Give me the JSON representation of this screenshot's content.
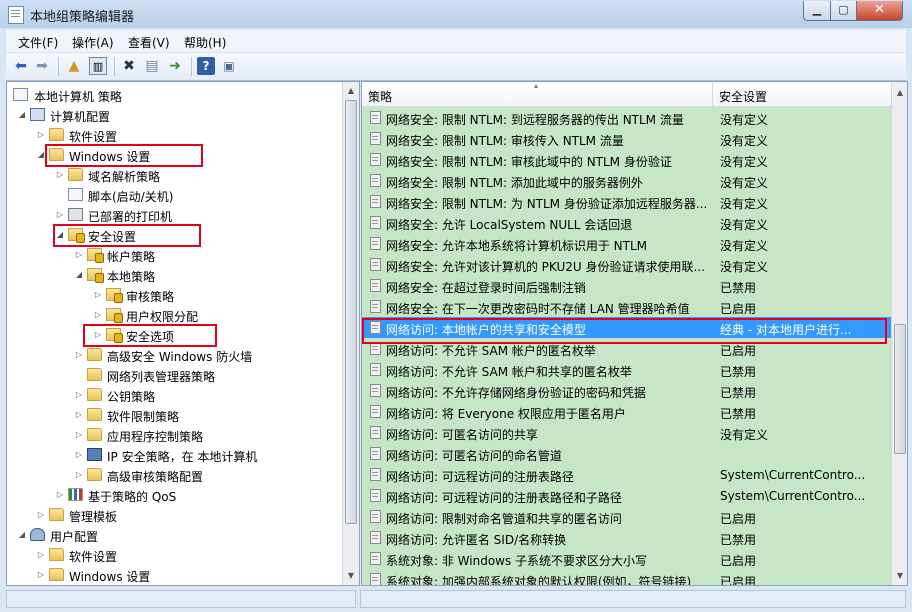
{
  "window": {
    "title": "本地组策略编辑器"
  },
  "menu": [
    "文件(F)",
    "操作(A)",
    "查看(V)",
    "帮助(H)"
  ],
  "tree": [
    {
      "label": "本地计算机 策略",
      "icon": "computer-policy-icon",
      "level": 0,
      "toggle": ""
    },
    {
      "label": "计算机配置",
      "icon": "computer-icon",
      "level": 1,
      "toggle": "expanded"
    },
    {
      "label": "软件设置",
      "icon": "folder-icon",
      "level": 2,
      "toggle": "collapsed"
    },
    {
      "label": "Windows 设置",
      "icon": "folder-icon",
      "level": 2,
      "toggle": "expanded"
    },
    {
      "label": "域名解析策略",
      "icon": "folder-icon",
      "level": 3,
      "toggle": "collapsed"
    },
    {
      "label": "脚本(启动/关机)",
      "icon": "script-icon",
      "level": 3,
      "toggle": ""
    },
    {
      "label": "已部署的打印机",
      "icon": "printer-icon",
      "level": 3,
      "toggle": "collapsed"
    },
    {
      "label": "安全设置",
      "icon": "security-folder-icon",
      "level": 3,
      "toggle": "expanded"
    },
    {
      "label": "帐户策略",
      "icon": "security-folder-icon",
      "level": 4,
      "toggle": "collapsed"
    },
    {
      "label": "本地策略",
      "icon": "security-folder-icon",
      "level": 4,
      "toggle": "expanded"
    },
    {
      "label": "审核策略",
      "icon": "security-folder-icon",
      "level": 5,
      "toggle": "collapsed"
    },
    {
      "label": "用户权限分配",
      "icon": "security-folder-icon",
      "level": 5,
      "toggle": "collapsed"
    },
    {
      "label": "安全选项",
      "icon": "security-folder-icon",
      "level": 5,
      "toggle": "collapsed"
    },
    {
      "label": "高级安全 Windows 防火墙",
      "icon": "folder-icon",
      "level": 4,
      "toggle": "collapsed"
    },
    {
      "label": "网络列表管理器策略",
      "icon": "folder-icon",
      "level": 4,
      "toggle": ""
    },
    {
      "label": "公钥策略",
      "icon": "folder-icon",
      "level": 4,
      "toggle": "collapsed"
    },
    {
      "label": "软件限制策略",
      "icon": "folder-icon",
      "level": 4,
      "toggle": "collapsed"
    },
    {
      "label": "应用程序控制策略",
      "icon": "folder-icon",
      "level": 4,
      "toggle": "collapsed"
    },
    {
      "label": "IP 安全策略，在 本地计算机",
      "icon": "ip-security-icon",
      "level": 4,
      "toggle": "collapsed"
    },
    {
      "label": "高级审核策略配置",
      "icon": "folder-icon",
      "level": 4,
      "toggle": "collapsed"
    },
    {
      "label": "基于策略的 QoS",
      "icon": "qos-chart-icon",
      "level": 3,
      "toggle": "collapsed"
    },
    {
      "label": "管理模板",
      "icon": "folder-icon",
      "level": 2,
      "toggle": "collapsed"
    },
    {
      "label": "用户配置",
      "icon": "user-icon",
      "level": 1,
      "toggle": "expanded"
    },
    {
      "label": "软件设置",
      "icon": "folder-icon",
      "level": 2,
      "toggle": "collapsed"
    },
    {
      "label": "Windows 设置",
      "icon": "folder-icon",
      "level": 2,
      "toggle": "collapsed"
    }
  ],
  "columns": {
    "policy": "策略",
    "setting": "安全设置"
  },
  "rows": [
    {
      "policy": "网络安全: 限制 NTLM: 到远程服务器的传出 NTLM 流量",
      "setting": "没有定义"
    },
    {
      "policy": "网络安全: 限制 NTLM: 审核传入 NTLM 流量",
      "setting": "没有定义"
    },
    {
      "policy": "网络安全: 限制 NTLM: 审核此域中的 NTLM 身份验证",
      "setting": "没有定义"
    },
    {
      "policy": "网络安全: 限制 NTLM: 添加此域中的服务器例外",
      "setting": "没有定义"
    },
    {
      "policy": "网络安全: 限制 NTLM: 为 NTLM 身份验证添加远程服务器...",
      "setting": "没有定义"
    },
    {
      "policy": "网络安全: 允许 LocalSystem NULL 会话回退",
      "setting": "没有定义"
    },
    {
      "policy": "网络安全: 允许本地系统将计算机标识用于 NTLM",
      "setting": "没有定义"
    },
    {
      "policy": "网络安全: 允许对该计算机的 PKU2U 身份验证请求使用联...",
      "setting": "没有定义"
    },
    {
      "policy": "网络安全: 在超过登录时间后强制注销",
      "setting": "已禁用"
    },
    {
      "policy": "网络安全: 在下一次更改密码时不存储 LAN 管理器哈希值",
      "setting": "已启用"
    },
    {
      "policy": "网络访问: 本地帐户的共享和安全模型",
      "setting": "经典 - 对本地用户进行..."
    },
    {
      "policy": "网络访问: 不允许 SAM 帐户的匿名枚举",
      "setting": "已启用"
    },
    {
      "policy": "网络访问: 不允许 SAM 帐户和共享的匿名枚举",
      "setting": "已禁用"
    },
    {
      "policy": "网络访问: 不允许存储网络身份验证的密码和凭据",
      "setting": "已禁用"
    },
    {
      "policy": "网络访问: 将 Everyone 权限应用于匿名用户",
      "setting": "已禁用"
    },
    {
      "policy": "网络访问: 可匿名访问的共享",
      "setting": "没有定义"
    },
    {
      "policy": "网络访问: 可匿名访问的命名管道",
      "setting": ""
    },
    {
      "policy": "网络访问: 可远程访问的注册表路径",
      "setting": "System\\CurrentContro..."
    },
    {
      "policy": "网络访问: 可远程访问的注册表路径和子路径",
      "setting": "System\\CurrentContro..."
    },
    {
      "policy": "网络访问: 限制对命名管道和共享的匿名访问",
      "setting": "已启用"
    },
    {
      "policy": "网络访问: 允许匿名 SID/名称转换",
      "setting": "已禁用"
    },
    {
      "policy": "系统对象: 非 Windows 子系统不要求区分大小写",
      "setting": "已启用"
    },
    {
      "policy": "系统对象: 加强内部系统对象的默认权限(例如，符号链接)",
      "setting": "已启用"
    }
  ],
  "selected_row": 10,
  "colors": {
    "list_background": "#c6e6c6",
    "selection": "#3399ff",
    "highlight_box": "#e4001b"
  },
  "toolbar_icons": [
    "back-arrow-icon",
    "forward-arrow-icon",
    "up-folder-icon",
    "show-hide-tree-icon",
    "delete-icon",
    "properties-icon",
    "export-list-icon",
    "help-icon",
    "extended-view-icon"
  ]
}
